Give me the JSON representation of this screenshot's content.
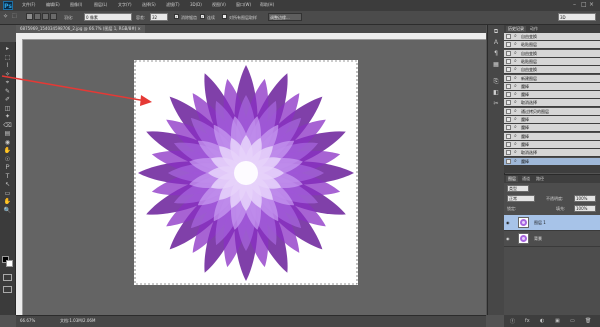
{
  "app": {
    "logo": "Ps"
  },
  "menu": [
    "文件(F)",
    "编辑(E)",
    "图像(I)",
    "图层(L)",
    "文字(Y)",
    "选择(S)",
    "滤镜(T)",
    "3D(D)",
    "视图(V)",
    "窗口(W)",
    "帮助(H)"
  ],
  "window_controls": {
    "minimize": "–",
    "maximize": "□",
    "close": "×"
  },
  "options": {
    "tool_preset": "⬚",
    "feather_label": "羽化:",
    "feather_value": "0 像素",
    "tolerance_label": "容差:",
    "tolerance_value": "32",
    "antialias_label": "消除锯齿",
    "contiguous_label": "连续",
    "all_layers_label": "对所有图层取样",
    "refine_edge_label": "调整边缘...",
    "workspace": "3D"
  },
  "document": {
    "tab_title": "6875969_154034598706_2.jpg @ 66.7% (图层 1, RGB/8#) ×",
    "zoom": "66.67%",
    "doc_info": "文档:1.03M/2.06M"
  },
  "tools": [
    "▸",
    "⬚",
    "⌇",
    "✧",
    "⌖",
    "✎",
    "✐",
    "◫",
    "✦",
    "⌫",
    "▤",
    "◉",
    "✋",
    "☉",
    "Ｐ",
    "Ｔ",
    "↖",
    "▭",
    "✋",
    "🔍"
  ],
  "colors": {
    "foreground": "#000000",
    "background": "#ffffff",
    "accent": "#9fb8d8",
    "arrow": "#e53935"
  },
  "dock_icons": [
    "⧉",
    "Ａ",
    "¶",
    "▦",
    "⎘",
    "◧",
    "✂"
  ],
  "history": {
    "tabs": [
      "历史记录",
      "动作"
    ],
    "items": [
      {
        "label": "自由变换",
        "active": false
      },
      {
        "label": "粘贴图层",
        "active": false
      },
      {
        "label": "自由变换",
        "active": false
      },
      {
        "label": "粘贴图层",
        "active": false
      },
      {
        "label": "自由变换",
        "active": false
      },
      {
        "label": "新建图层",
        "active": false
      },
      {
        "label": "魔棒",
        "active": false
      },
      {
        "label": "魔棒",
        "active": false
      },
      {
        "label": "取消选择",
        "active": false
      },
      {
        "label": "通过拷贝的图层",
        "active": false
      },
      {
        "label": "魔棒",
        "active": false
      },
      {
        "label": "魔棒",
        "active": false
      },
      {
        "label": "魔棒",
        "active": false
      },
      {
        "label": "魔棒",
        "active": false
      },
      {
        "label": "取消选择",
        "active": false
      },
      {
        "label": "魔棒",
        "active": true
      }
    ]
  },
  "layers": {
    "tabs": [
      "图层",
      "通道",
      "路径"
    ],
    "kind_filter": "类型",
    "blend_mode": "正常",
    "opacity_label": "不透明度:",
    "opacity_value": "100%",
    "lock_label": "锁定:",
    "fill_label": "填充:",
    "fill_value": "100%",
    "items": [
      {
        "name": "图层 1",
        "selected": true
      },
      {
        "name": "背景",
        "selected": false
      }
    ],
    "footer_icons": [
      "ⓕ",
      "fx",
      "◐",
      "▣",
      "▭",
      "🗑"
    ]
  },
  "flower": {
    "petal_colors": [
      "#6a1f9a",
      "#8a2fc4",
      "#a866e0",
      "#c79af0",
      "#e6d2fa"
    ]
  }
}
